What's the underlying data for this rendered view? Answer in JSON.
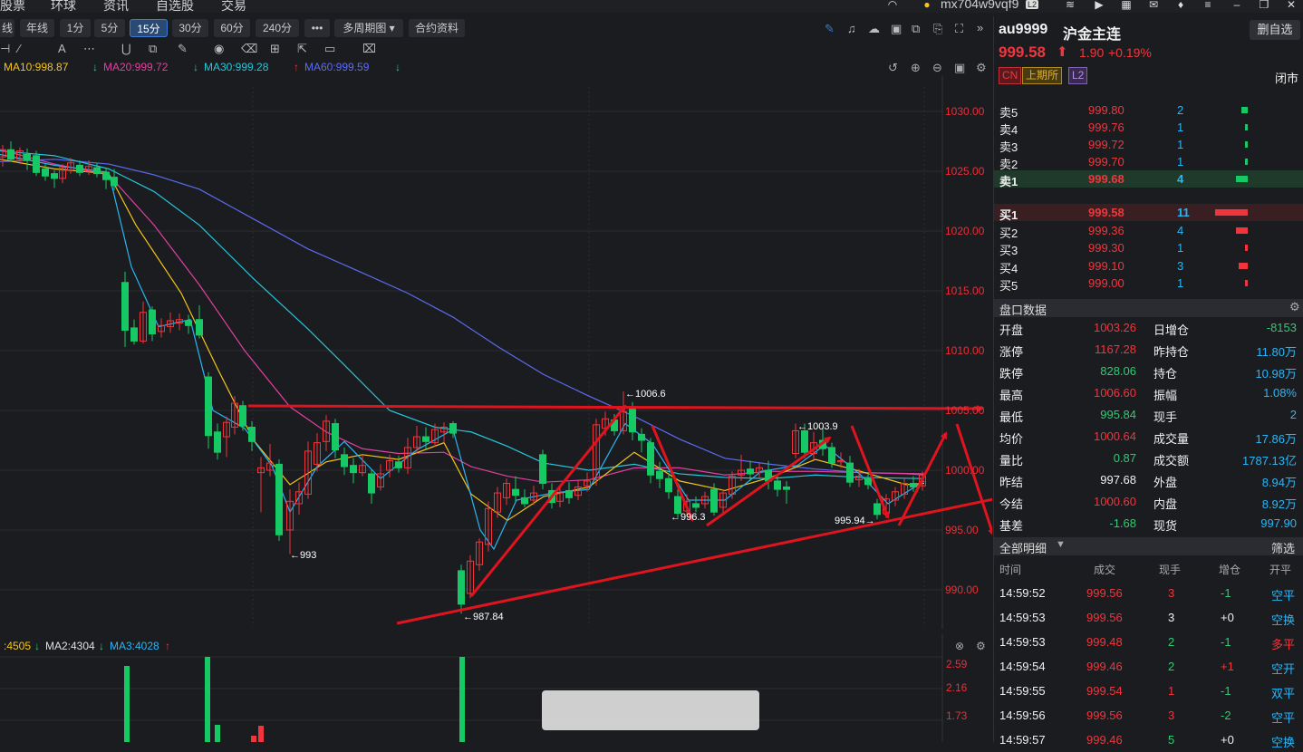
{
  "topnav": {
    "items": [
      "股票",
      "环球",
      "资讯",
      "自选股",
      "交易"
    ],
    "account": "mx704w9vqf9",
    "level_badge": "L2"
  },
  "toolbar": {
    "periods": [
      "线",
      "年线",
      "1分",
      "5分",
      "15分",
      "30分",
      "60分",
      "240分",
      "•••",
      "多周期图 ▾",
      "合约资料"
    ],
    "active_period": "15分"
  },
  "ma_legend": [
    {
      "label": "MA10:998.87",
      "color": "#f5c518",
      "arrow": ""
    },
    {
      "label": "MA20:999.72",
      "color": "#e040a0",
      "arrow": "↓"
    },
    {
      "label": "MA30:999.28",
      "color": "#26c6da",
      "arrow": "↓"
    },
    {
      "label": "MA60:999.59",
      "color": "#5c6bf0",
      "arrow": "↑"
    }
  ],
  "price_axis": [
    "1030.00",
    "1025.00",
    "1020.00",
    "1015.00",
    "1010.00",
    "1005.00",
    "1000.00",
    "995.00",
    "990.00"
  ],
  "annotations": {
    "high_label": "←1006.6",
    "mid_high_label": "←1003.9",
    "low1_label": "←993",
    "low2_label": "←987.84",
    "low3_label": "←996.3",
    "low4_label": "995.94→"
  },
  "vol_legend": [
    {
      "label": ":4505",
      "color": "#f5c518",
      "arrow": "↓"
    },
    {
      "label": "MA2:4304",
      "color": "#e0e0e0",
      "arrow": "↓"
    },
    {
      "label": "MA3:4028",
      "color": "#29b6f6",
      "arrow": "↑"
    }
  ],
  "vol_axis": [
    "2.59",
    "2.16",
    "1.73"
  ],
  "quote": {
    "code": "au9999",
    "name": "沪金主连",
    "price": "999.58",
    "change": "1.90",
    "change_pct": "+0.19%",
    "tags": [
      "CN",
      "上期所",
      "L2"
    ],
    "delete_btn": "删自选",
    "status": "闭市"
  },
  "order_book": {
    "asks": [
      {
        "label": "卖5",
        "price": "999.80",
        "qty": "2"
      },
      {
        "label": "卖4",
        "price": "999.76",
        "qty": "1"
      },
      {
        "label": "卖3",
        "price": "999.72",
        "qty": "1"
      },
      {
        "label": "卖2",
        "price": "999.70",
        "qty": "1"
      },
      {
        "label": "卖1",
        "price": "999.68",
        "qty": "4"
      }
    ],
    "bids": [
      {
        "label": "买1",
        "price": "999.58",
        "qty": "11"
      },
      {
        "label": "买2",
        "price": "999.36",
        "qty": "4"
      },
      {
        "label": "买3",
        "price": "999.30",
        "qty": "1"
      },
      {
        "label": "买4",
        "price": "999.10",
        "qty": "3"
      },
      {
        "label": "买5",
        "price": "999.00",
        "qty": "1"
      }
    ]
  },
  "market_data": {
    "title": "盘口数据",
    "left": [
      {
        "k": "开盘",
        "v": "1003.26",
        "c": "red"
      },
      {
        "k": "涨停",
        "v": "1167.28",
        "c": "red"
      },
      {
        "k": "跌停",
        "v": "828.06",
        "c": "green"
      },
      {
        "k": "最高",
        "v": "1006.60",
        "c": "red"
      },
      {
        "k": "最低",
        "v": "995.84",
        "c": "green"
      },
      {
        "k": "均价",
        "v": "1000.64",
        "c": "red"
      },
      {
        "k": "量比",
        "v": "0.87",
        "c": "green"
      },
      {
        "k": "昨结",
        "v": "997.68",
        "c": "white"
      },
      {
        "k": "今结",
        "v": "1000.60",
        "c": "red"
      },
      {
        "k": "基差",
        "v": "-1.68",
        "c": "green"
      }
    ],
    "right": [
      {
        "k": "日增仓",
        "v": "-8153",
        "c": "green"
      },
      {
        "k": "昨持仓",
        "v": "11.80万",
        "c": "cyan"
      },
      {
        "k": "持仓",
        "v": "10.98万",
        "c": "cyan"
      },
      {
        "k": "振幅",
        "v": "1.08%",
        "c": "cyan"
      },
      {
        "k": "现手",
        "v": "2",
        "c": "cyan"
      },
      {
        "k": "成交量",
        "v": "17.86万",
        "c": "cyan"
      },
      {
        "k": "成交额",
        "v": "1787.13亿",
        "c": "cyan"
      },
      {
        "k": "外盘",
        "v": "8.94万",
        "c": "cyan"
      },
      {
        "k": "内盘",
        "v": "8.92万",
        "c": "cyan"
      },
      {
        "k": "现货",
        "v": "997.90",
        "c": "cyan"
      }
    ]
  },
  "trades": {
    "title": "全部明细",
    "filter": "筛选",
    "headers": [
      "时间",
      "成交",
      "现手",
      "增仓",
      "开平"
    ],
    "rows": [
      {
        "time": "14:59:52",
        "price": "999.56",
        "pc": "red",
        "vol": "3",
        "vc": "red",
        "oi": "-1",
        "oc": "green",
        "type": "空平",
        "tc": "cyan"
      },
      {
        "time": "14:59:53",
        "price": "999.56",
        "pc": "red",
        "vol": "3",
        "vc": "white",
        "oi": "+0",
        "oc": "white",
        "type": "空换",
        "tc": "cyan"
      },
      {
        "time": "14:59:53",
        "price": "999.48",
        "pc": "red",
        "vol": "2",
        "vc": "green",
        "oi": "-1",
        "oc": "green",
        "type": "多平",
        "tc": "red"
      },
      {
        "time": "14:59:54",
        "price": "999.46",
        "pc": "red",
        "vol": "2",
        "vc": "green",
        "oi": "+1",
        "oc": "red",
        "type": "空开",
        "tc": "cyan"
      },
      {
        "time": "14:59:55",
        "price": "999.54",
        "pc": "red",
        "vol": "1",
        "vc": "red",
        "oi": "-1",
        "oc": "green",
        "type": "双平",
        "tc": "cyan"
      },
      {
        "time": "14:59:56",
        "price": "999.56",
        "pc": "red",
        "vol": "3",
        "vc": "red",
        "oi": "-2",
        "oc": "green",
        "type": "空平",
        "tc": "cyan"
      },
      {
        "time": "14:59:57",
        "price": "999.46",
        "pc": "red",
        "vol": "5",
        "vc": "green",
        "oi": "+0",
        "oc": "white",
        "type": "空换",
        "tc": "cyan"
      }
    ]
  },
  "colors": {
    "up": "#f0363c",
    "down": "#17c964",
    "bg": "#1b1c20",
    "annotation": "#e0141e"
  }
}
